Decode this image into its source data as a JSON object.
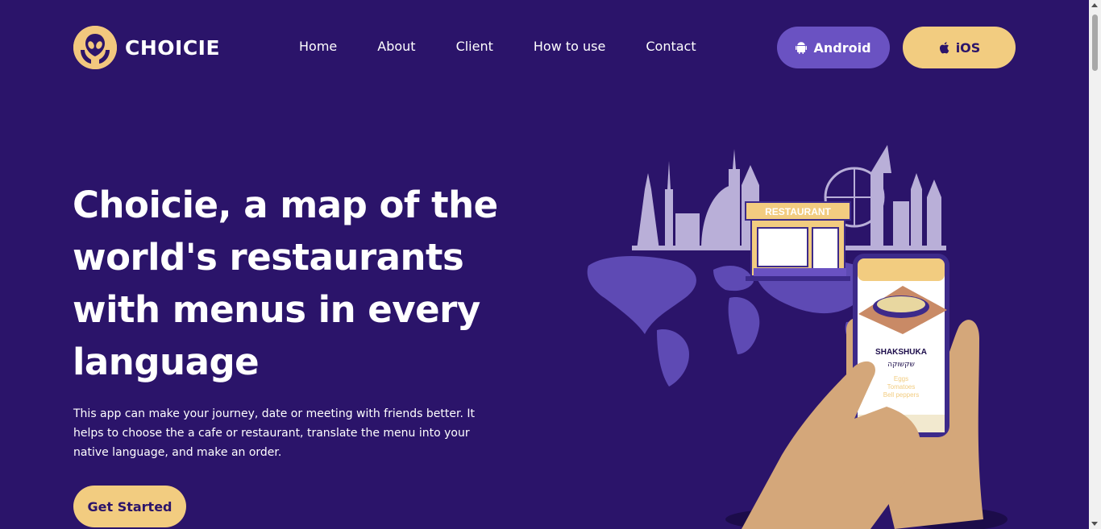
{
  "header": {
    "brand": "CHOICIE",
    "nav": [
      "Home",
      "About",
      "Client",
      "How to use",
      "Contact"
    ],
    "android_label": "Android",
    "ios_label": "iOS"
  },
  "hero": {
    "title": "Choicie, a map of the world's restaurants with menus in every language",
    "description": "This app can make your journey, date or meeting with friends better. It helps to choose the a cafe or restaurant, translate the menu into your native language, and make an order.",
    "cta": "Get Started"
  },
  "illustration": {
    "sign": "RESTAURANT",
    "dish_name": "SHAKSHUKA",
    "dish_name_hebrew": "שקשוקה",
    "ingredients": [
      "Eggs",
      "Tomatoes",
      "Bell peppers"
    ]
  },
  "colors": {
    "background": "#2b146a",
    "accent_yellow": "#f2cc80",
    "accent_purple": "#6a52c2",
    "text": "#ffffff"
  }
}
